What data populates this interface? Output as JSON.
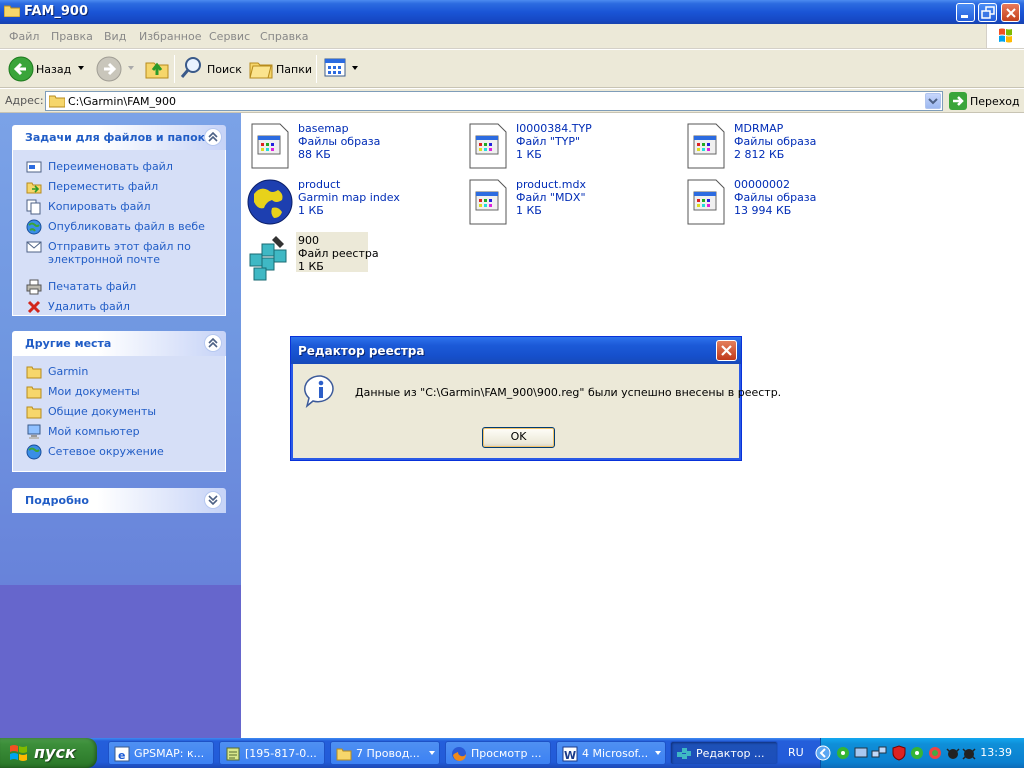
{
  "window": {
    "title": "FAM_900"
  },
  "menu": [
    "Файл",
    "Правка",
    "Вид",
    "Избранное",
    "Сервис",
    "Справка"
  ],
  "toolbar": {
    "back_label": "Назад",
    "search_label": "Поиск",
    "folders_label": "Папки"
  },
  "address": {
    "label": "Адрес:",
    "value": "C:\\Garmin\\FAM_900",
    "go_label": "Переход"
  },
  "tasks_panel": {
    "title": "Задачи для файлов и папок",
    "items": [
      {
        "label": "Переименовать файл",
        "icon": "rename-icon"
      },
      {
        "label": "Переместить файл",
        "icon": "move-icon"
      },
      {
        "label": "Копировать файл",
        "icon": "copy-icon"
      },
      {
        "label": "Опубликовать файл в вебе",
        "icon": "globe-icon"
      },
      {
        "label_line1": "Отправить этот файл по",
        "label_line2": "электронной почте",
        "icon": "mail-icon"
      },
      {
        "label": "Печатать файл",
        "icon": "printer-icon"
      },
      {
        "label": "Удалить файл",
        "icon": "delete-icon"
      }
    ]
  },
  "places_panel": {
    "title": "Другие места",
    "items": [
      {
        "label": "Garmin",
        "icon": "folder-icon"
      },
      {
        "label": "Мои документы",
        "icon": "folder-icon"
      },
      {
        "label": "Общие документы",
        "icon": "folder-icon"
      },
      {
        "label": "Мой компьютер",
        "icon": "computer-icon"
      },
      {
        "label": "Сетевое окружение",
        "icon": "network-icon"
      }
    ]
  },
  "details_panel": {
    "title": "Подробно"
  },
  "files": [
    {
      "name": "basemap",
      "type": "Файлы образа",
      "size": "88 КБ",
      "icon": "document-icon"
    },
    {
      "name": "I0000384.TYP",
      "type": "Файл \"TYP\"",
      "size": "1 КБ",
      "icon": "document-icon"
    },
    {
      "name": "MDRMAP",
      "type": "Файлы образа",
      "size": "2 812 КБ",
      "icon": "document-icon"
    },
    {
      "name": "product",
      "type": "Garmin map index",
      "size": "1 КБ",
      "icon": "globe-map-icon"
    },
    {
      "name": "product.mdx",
      "type": "Файл \"MDX\"",
      "size": "1 КБ",
      "icon": "document-icon"
    },
    {
      "name": "00000002",
      "type": "Файлы образа",
      "size": "13 994 КБ",
      "icon": "document-icon"
    },
    {
      "name": "900",
      "type": "Файл реестра",
      "size": "1 КБ",
      "icon": "registry-icon",
      "selected": true
    }
  ],
  "dialog": {
    "title": "Редактор реестра",
    "message": "Данные из \"C:\\Garmin\\FAM_900\\900.reg\" были успешно внесены в реестр.",
    "ok_label": "OK"
  },
  "taskbar": {
    "start_label": "пуск",
    "buttons": [
      {
        "label": "GPSMAP: к...",
        "icon": "ie-icon"
      },
      {
        "label": "[195-817-0...",
        "icon": "notepad-icon"
      },
      {
        "label": "7 Провод...",
        "icon": "folder-icon",
        "group": true
      },
      {
        "label": "Просмотр ...",
        "icon": "firefox-icon"
      },
      {
        "label": "4 Microsof...",
        "icon": "word-icon",
        "group": true
      },
      {
        "label": "Редактор ...",
        "icon": "regedit-icon",
        "active": true
      }
    ],
    "language": "RU",
    "clock": "13:39"
  }
}
